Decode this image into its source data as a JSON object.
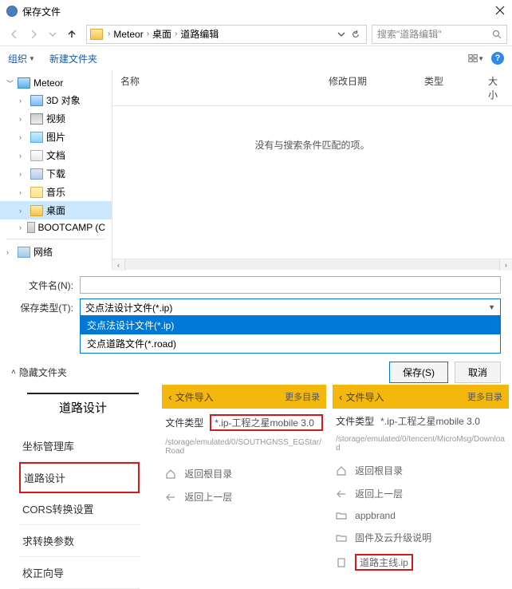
{
  "dialog": {
    "title": "保存文件",
    "breadcrumb": {
      "p1": "Meteor",
      "p2": "桌面",
      "p3": "道路编辑"
    },
    "search_placeholder": "搜索\"道路编辑\"",
    "toolbar": {
      "organize": "组织",
      "new_folder": "新建文件夹"
    },
    "sidebar": {
      "items": [
        {
          "label": "Meteor"
        },
        {
          "label": "3D 对象"
        },
        {
          "label": "视频"
        },
        {
          "label": "图片"
        },
        {
          "label": "文档"
        },
        {
          "label": "下载"
        },
        {
          "label": "音乐"
        },
        {
          "label": "桌面"
        },
        {
          "label": "BOOTCAMP (C"
        },
        {
          "label": "网络"
        }
      ]
    },
    "columns": {
      "name": "名称",
      "date": "修改日期",
      "type": "类型",
      "size": "大小"
    },
    "empty_msg": "没有与搜索条件匹配的项。",
    "filename_label": "文件名(N):",
    "filetype_label": "保存类型(T):",
    "filetype_value": "交点法设计文件(*.ip)",
    "dd_opts": [
      "交点法设计文件(*.ip)",
      "交点道路文件(*.road)"
    ],
    "hide_folders": "隐藏文件夹",
    "save_btn": "保存(S)",
    "cancel_btn": "取消"
  },
  "menu": {
    "title": "道路设计",
    "items": [
      "坐标管理库",
      "道路设计",
      "CORS转换设置",
      "求转换参数",
      "校正向导"
    ]
  },
  "mobile1": {
    "header_title": "文件导入",
    "header_more": "更多目录",
    "filetype_label": "文件类型",
    "filetype_value": "*.ip-工程之星mobile 3.0",
    "path": "/storage/emulated/0/SOUTHGNSS_EGStar/Road",
    "line_home": "返回根目录",
    "line_up": "返回上一层"
  },
  "mobile2": {
    "header_title": "文件导入",
    "header_more": "更多目录",
    "filetype_label": "文件类型",
    "filetype_value": "*.ip-工程之星mobile 3.0",
    "path": "/storage/emulated/0/tencent/MicroMsg/Download",
    "line_home": "返回根目录",
    "line_up": "返回上一层",
    "folders": [
      "appbrand",
      "固件及云升级说明"
    ],
    "file": "道路主线.ip"
  }
}
